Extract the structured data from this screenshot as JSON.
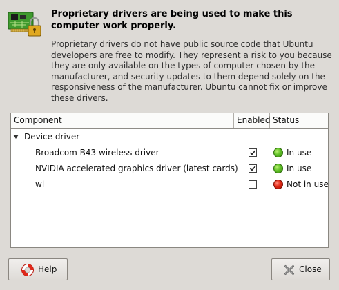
{
  "header": {
    "title": "Proprietary drivers are being used to make this computer work properly.",
    "description": "Proprietary drivers do not have public source code that Ubuntu developers are free to modify. They represent a risk to you because they are only available on the types of computer chosen by the manufacturer, and security updates to them depend solely on the responsiveness of the manufacturer. Ubuntu cannot fix or improve these drivers.",
    "icon": "hardware-card-lock-icon"
  },
  "table": {
    "columns": [
      "Component",
      "Enabled",
      "Status"
    ],
    "group": {
      "label": "Device driver",
      "expanded": true
    },
    "rows": [
      {
        "label": "Broadcom B43 wireless driver",
        "enabled": true,
        "status": "In use",
        "status_color": "#4caf20"
      },
      {
        "label": "NVIDIA accelerated graphics driver (latest cards)",
        "enabled": true,
        "status": "In use",
        "status_color": "#4caf20"
      },
      {
        "label": "wl",
        "enabled": false,
        "status": "Not in use",
        "status_color": "#d42210"
      }
    ]
  },
  "buttons": {
    "help": {
      "first": "H",
      "rest": "elp",
      "icon": "lifebuoy-icon"
    },
    "close": {
      "first": "C",
      "rest": "lose",
      "icon": "close-icon"
    }
  }
}
